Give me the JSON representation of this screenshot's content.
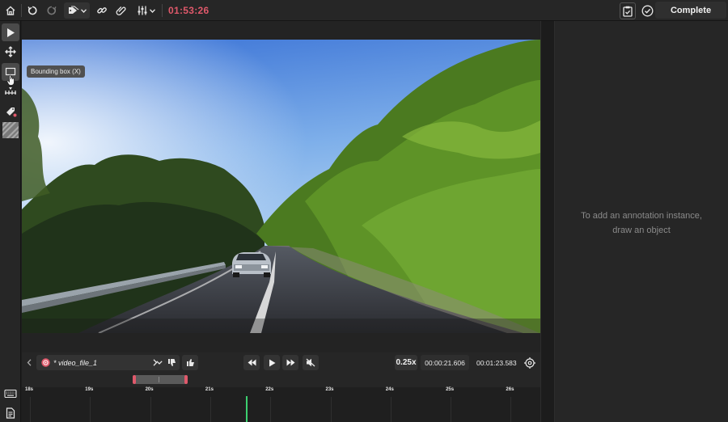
{
  "toolbar": {
    "timer": "01:53:26",
    "complete_label": "Complete"
  },
  "tooltip": {
    "text": "Bounding box (X)"
  },
  "player": {
    "file_name": "* video_file_1",
    "playback_rate": "0.25x",
    "current_time": "00:00:21.606",
    "duration": "00:01:23.583"
  },
  "timeline": {
    "ticks": [
      "18s",
      "19s",
      "20s",
      "21s",
      "22s",
      "23s",
      "24s",
      "25s",
      "26s"
    ]
  },
  "panel": {
    "empty_line1": "To add an annotation instance,",
    "empty_line2": "draw an object"
  },
  "colors": {
    "accent": "#e0596b",
    "playhead": "#3cd070"
  }
}
